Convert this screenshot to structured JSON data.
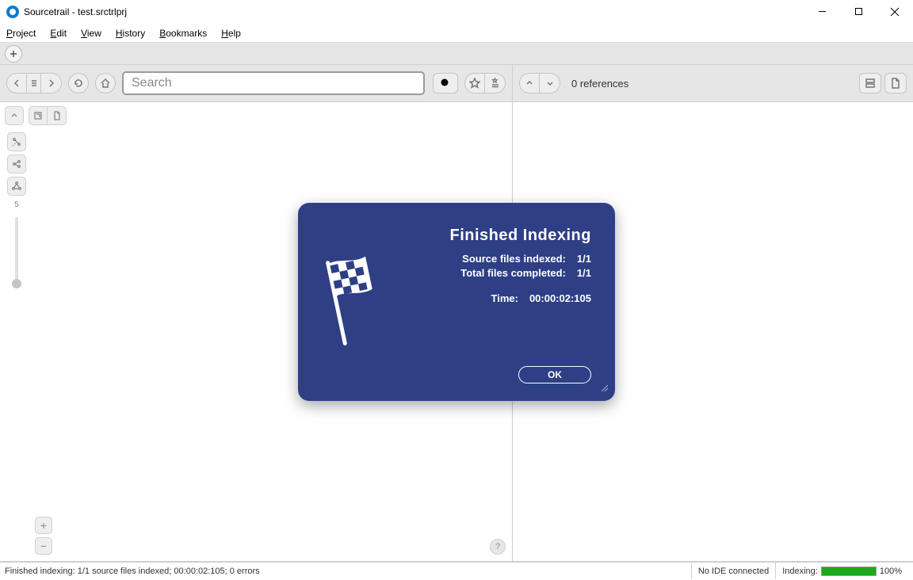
{
  "window": {
    "title": "Sourcetrail - test.srctrlprj"
  },
  "menu": {
    "project": "Project",
    "edit": "Edit",
    "view": "View",
    "history": "History",
    "bookmarks": "Bookmarks",
    "help": "Help"
  },
  "toolbar": {
    "search_placeholder": "Search"
  },
  "references": {
    "count_text": "0 references"
  },
  "side": {
    "depth_label": "5"
  },
  "modal": {
    "heading": "Finished Indexing",
    "source_label": "Source files indexed:",
    "source_value": "1/1",
    "total_label": "Total files completed:",
    "total_value": "1/1",
    "time_label": "Time:",
    "time_value": "00:00:02:105",
    "ok": "OK"
  },
  "status": {
    "message": "Finished indexing: 1/1 source files indexed; 00:00:02:105; 0 errors",
    "ide": "No IDE connected",
    "indexing_label": "Indexing:",
    "percent": "100%"
  },
  "help_glyph": "?"
}
